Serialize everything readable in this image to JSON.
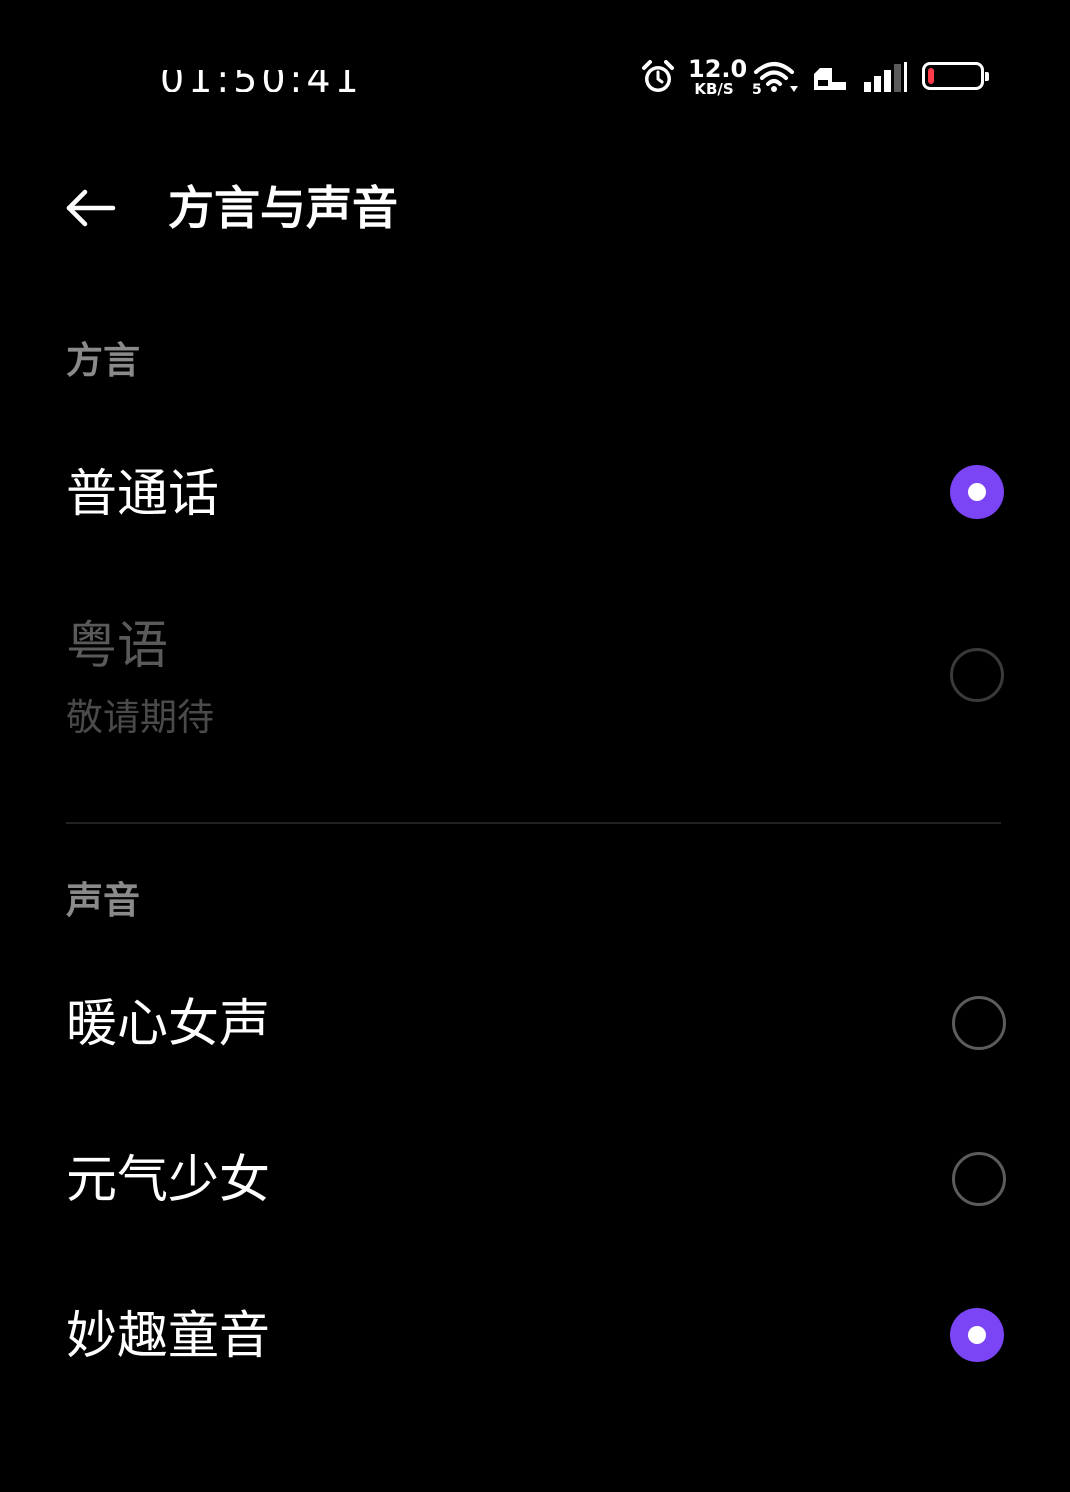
{
  "status_bar": {
    "time": "01:50:41",
    "net_speed_value": "12.0",
    "net_speed_unit": "KB/S",
    "wifi_badge": "5",
    "battery_level": 0.12,
    "battery_color": "#ff3b4a",
    "icons": [
      "alarm-icon",
      "wifi-icon",
      "sim-icon",
      "signal-icon",
      "battery-icon"
    ]
  },
  "toolbar": {
    "back_icon": "arrow-left-icon",
    "title": "方言与声音"
  },
  "sections": [
    {
      "header": "方言",
      "options": [
        {
          "label": "普通话",
          "selected": true,
          "disabled": false
        },
        {
          "label": "粤语",
          "sublabel": "敬请期待",
          "selected": false,
          "disabled": true
        }
      ]
    },
    {
      "header": "声音",
      "options": [
        {
          "label": "暖心女声",
          "selected": false,
          "disabled": false
        },
        {
          "label": "元气少女",
          "selected": false,
          "disabled": false
        },
        {
          "label": "妙趣童音",
          "selected": true,
          "disabled": false
        }
      ]
    }
  ],
  "colors": {
    "background": "#000000",
    "accent": "#7b44f5",
    "section_header": "#8a8a8a",
    "disabled_text": "#5a5a5a"
  }
}
